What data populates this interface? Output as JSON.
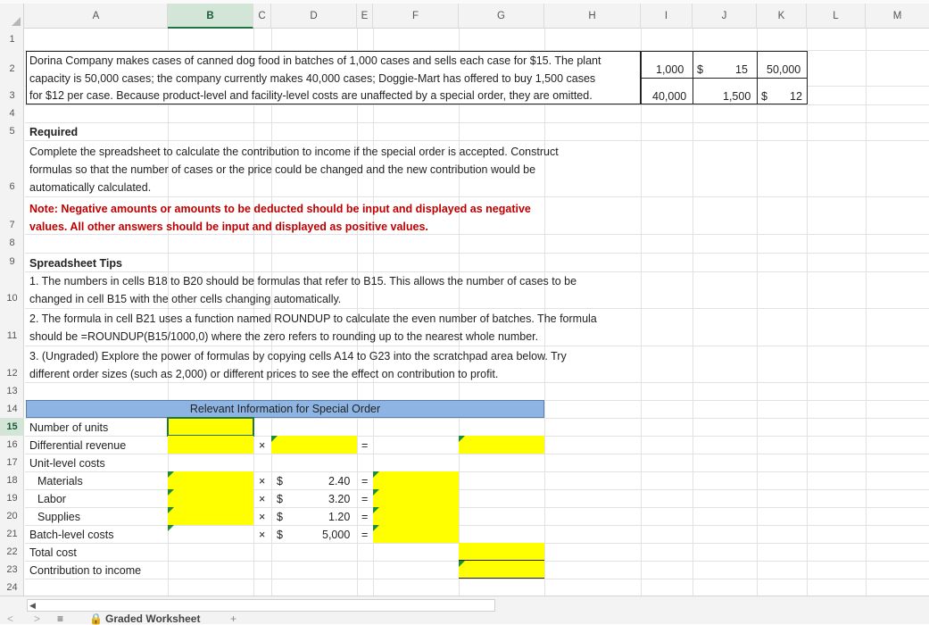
{
  "columns": [
    "A",
    "B",
    "C",
    "D",
    "E",
    "F",
    "G",
    "H",
    "I",
    "J",
    "K",
    "L",
    "M"
  ],
  "selected_column": "B",
  "rows": [
    "1",
    "2",
    "3",
    "4",
    "5",
    "6",
    "7",
    "8",
    "9",
    "10",
    "11",
    "12",
    "13",
    "14",
    "15",
    "16",
    "17",
    "18",
    "19",
    "20",
    "21",
    "22",
    "23",
    "24"
  ],
  "selected_row": "15",
  "intro": {
    "line1": "Dorina Company makes cases of canned dog food in batches of 1,000 cases and sells each case for $15. The plant",
    "line2": "capacity is 50,000 cases; the company currently makes 40,000 cases; Doggie-Mart has offered to buy 1,500 cases",
    "line3": "for $12 per case. Because product-level and facility-level costs are unaffected by a special order, they are omitted."
  },
  "given": {
    "r1_i": "1,000",
    "r1_j_sym": "$",
    "r1_j": "15",
    "r1_k": "50,000",
    "r2_i": "40,000",
    "r2_j": "1,500",
    "r2_k_sym": "$",
    "r2_k": "12"
  },
  "required": {
    "heading": "Required",
    "line1": "Complete the spreadsheet to calculate the contribution to income if the special order is accepted. Construct",
    "line2": "formulas so that the number of cases or the price could be changed and the new contribution would be",
    "line3": "automatically calculated."
  },
  "note": {
    "line1": "Note: Negative amounts or amounts to be deducted should be input and displayed as negative",
    "line2": "values. All other answers should be input and displayed as positive values."
  },
  "tips": {
    "heading": "Spreadsheet Tips",
    "t1a": "1. The numbers in cells B18 to B20 should be formulas that refer to B15. This allows the number of cases to be",
    "t1b": "changed in cell B15 with the other cells changing automatically.",
    "t2a": "2. The formula in cell B21 uses a function named ROUNDUP to calculate the even number of batches. The formula",
    "t2b": "should be =ROUNDUP(B15/1000,0) where the zero refers to rounding up to the nearest whole number.",
    "t3a": "3. (Ungraded) Explore the power of formulas by copying cells A14 to G23 into the scratchpad area below. Try",
    "t3b": "different order sizes (such as 2,000) or different prices to see the effect on contribution to profit."
  },
  "table": {
    "banner": "Relevant Information for Special Order",
    "labels": {
      "units": "Number of units",
      "revenue": "Differential revenue",
      "unit_costs": "Unit-level costs",
      "materials": "Materials",
      "labor": "Labor",
      "supplies": "Supplies",
      "batch": "Batch-level costs",
      "total": "Total cost",
      "contribution": "Contribution to income"
    },
    "times": "×",
    "equals": "=",
    "dollar": "$",
    "rates": {
      "materials": "2.40",
      "labor": "3.20",
      "supplies": "1.20",
      "batch": "5,000"
    }
  },
  "sheet_tab": "Graded Worksheet",
  "add_sheet": "+",
  "menu_glyph": "≡",
  "nav_prev": "<",
  "nav_next": ">",
  "scroll_left": "◀",
  "colors": {
    "input_yellow": "#ffff00",
    "banner_blue": "#8db4e2",
    "note_red": "#c00000",
    "select_green": "#217346"
  }
}
